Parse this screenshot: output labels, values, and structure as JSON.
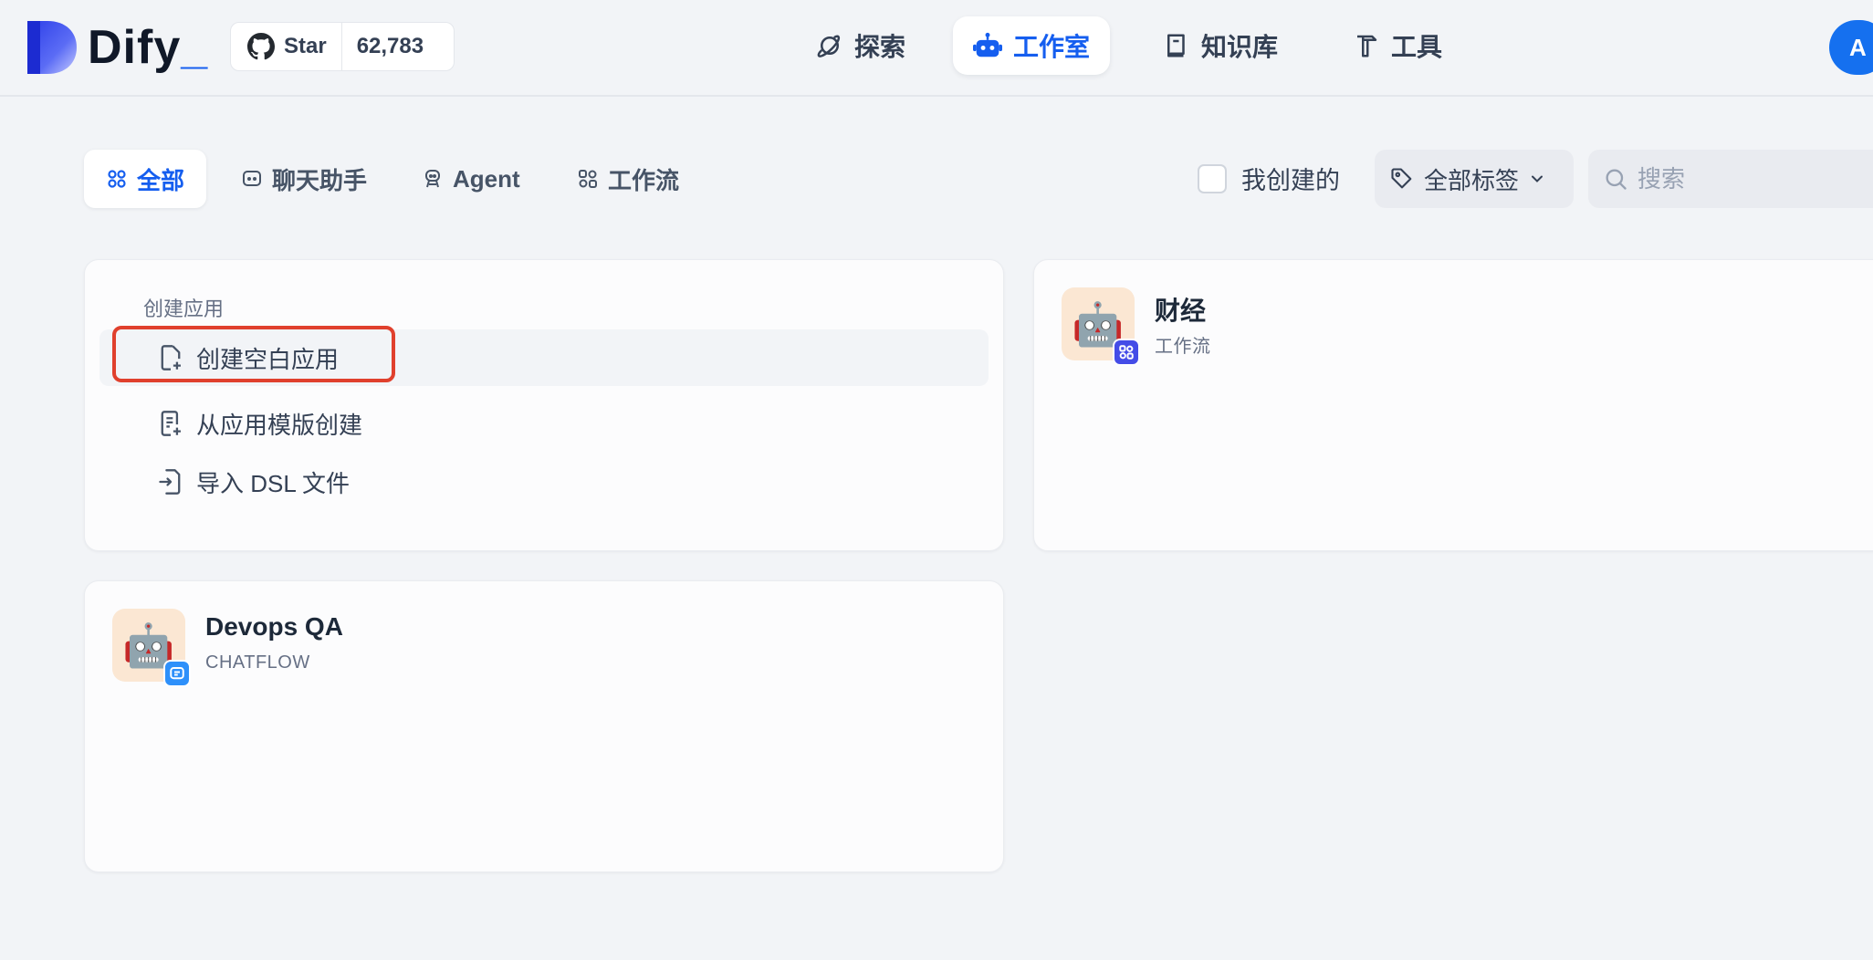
{
  "header": {
    "logo_text": "Dify",
    "logo_cursor": "_",
    "github": {
      "label": "Star",
      "count": "62,783"
    },
    "nav": [
      {
        "label": "探索",
        "icon": "planet-icon",
        "active": false
      },
      {
        "label": "工作室",
        "icon": "robot-icon",
        "active": true
      },
      {
        "label": "知识库",
        "icon": "book-icon",
        "active": false
      },
      {
        "label": "工具",
        "icon": "hammer-icon",
        "active": false
      }
    ],
    "avatar_letter": "A"
  },
  "filters": {
    "tabs": [
      {
        "label": "全部",
        "icon": "grid-icon",
        "active": true
      },
      {
        "label": "聊天助手",
        "icon": "chat-bubble-icon",
        "active": false
      },
      {
        "label": "Agent",
        "icon": "agent-icon",
        "active": false
      },
      {
        "label": "工作流",
        "icon": "workflow-icon",
        "active": false
      }
    ],
    "created_by_me": {
      "label": "我创建的",
      "checked": false
    },
    "tag_select": {
      "label": "全部标签"
    },
    "search": {
      "placeholder": "搜索",
      "value": ""
    }
  },
  "create_card": {
    "title": "创建应用",
    "items": [
      {
        "label": "创建空白应用",
        "icon": "file-plus-icon",
        "highlighted": true
      },
      {
        "label": "从应用模版创建",
        "icon": "file-template-icon",
        "highlighted": false
      },
      {
        "label": "导入 DSL 文件",
        "icon": "file-import-icon",
        "highlighted": false
      }
    ]
  },
  "apps": [
    {
      "name": "财经",
      "type": "工作流",
      "icon": "robot-emoji",
      "badge": "workflow-badge-icon"
    },
    {
      "name": "Devops QA",
      "type": "CHATFLOW",
      "icon": "robot-emoji",
      "badge": "chatflow-badge-icon"
    }
  ],
  "colors": {
    "accent": "#155eef",
    "background": "#f2f4f7",
    "highlight_border": "#e0402d",
    "icon_bg": "#fbe7d3",
    "workflow_badge": "#444ce7",
    "chatflow_badge": "#2e90fa",
    "avatar": "#1570ef"
  }
}
